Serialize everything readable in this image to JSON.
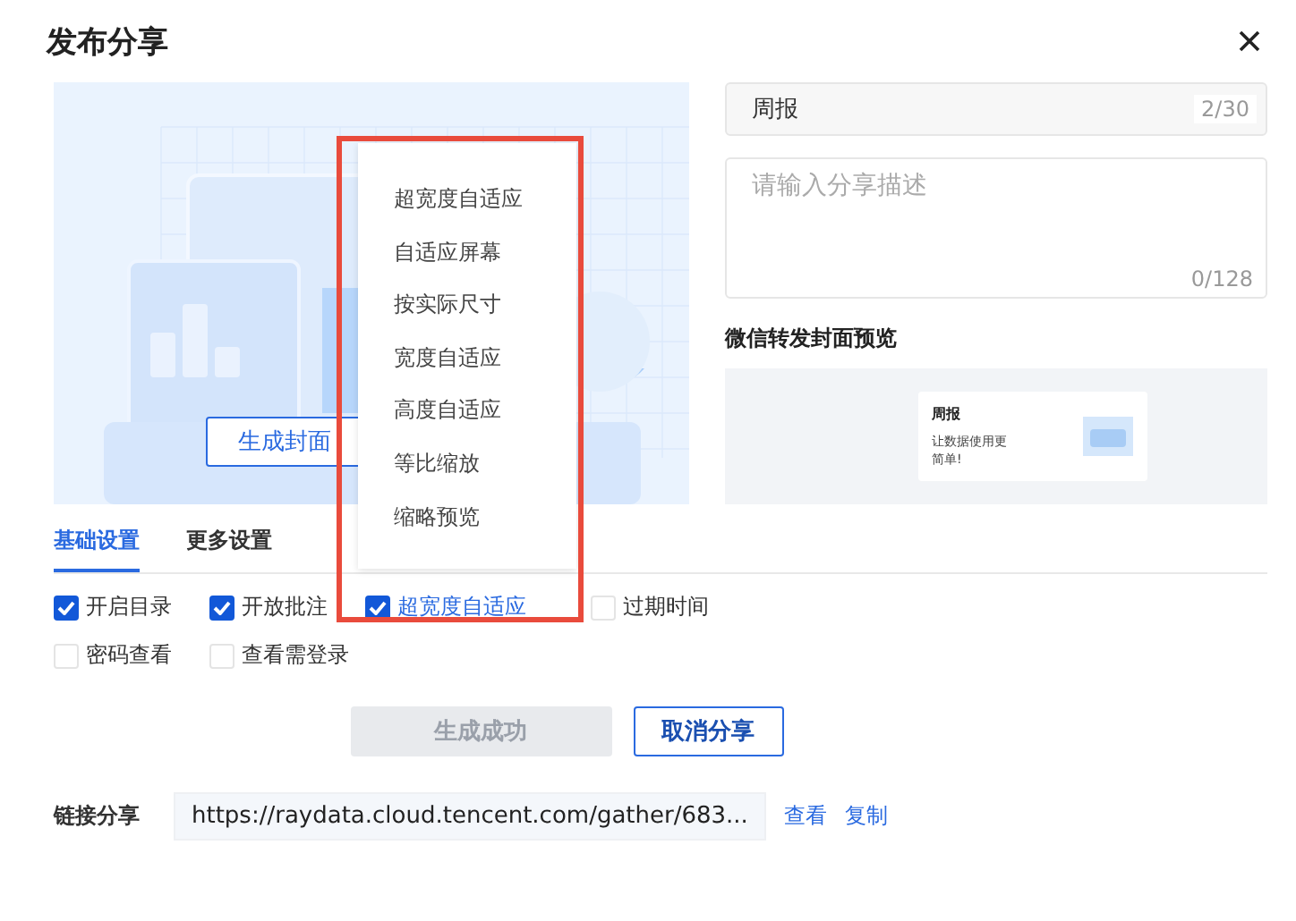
{
  "dialog": {
    "title": "发布分享"
  },
  "cover_button": {
    "label": "生成封面"
  },
  "fit_menu": {
    "items": [
      {
        "label": "超宽度自适应"
      },
      {
        "label": "自适应屏幕"
      },
      {
        "label": "按实际尺寸"
      },
      {
        "label": "宽度自适应"
      },
      {
        "label": "高度自适应"
      },
      {
        "label": "等比缩放"
      },
      {
        "label": "缩略预览"
      }
    ]
  },
  "title_field": {
    "value": "周报",
    "counter": "2/30"
  },
  "description_field": {
    "placeholder": "请输入分享描述",
    "counter": "0/128"
  },
  "preview": {
    "heading": "微信转发封面预览",
    "card_title": "周报",
    "card_text": "让数据使用更简单!"
  },
  "tabs": [
    {
      "label": "基础设置",
      "selected": true
    },
    {
      "label": "更多设置",
      "selected": false
    }
  ],
  "option_rows": [
    [
      {
        "kind": "checkbox",
        "label": "开启目录",
        "checked": true
      },
      {
        "kind": "checkbox",
        "label": "开放批注",
        "checked": true
      },
      {
        "kind": "select",
        "label": "超宽度自适应",
        "checked": true
      },
      {
        "kind": "checkbox",
        "label": "过期时间",
        "checked": false
      }
    ],
    [
      {
        "kind": "checkbox",
        "label": "密码查看",
        "checked": false
      },
      {
        "kind": "checkbox",
        "label": "查看需登录",
        "checked": false
      }
    ]
  ],
  "actions": {
    "generate": {
      "label": "生成成功",
      "disabled": true
    },
    "cancel": {
      "label": "取消分享"
    }
  },
  "link": {
    "label": "链接分享",
    "url": "https://raydata.cloud.tencent.com/gather/683...",
    "links": [
      "查看",
      "复制"
    ]
  }
}
